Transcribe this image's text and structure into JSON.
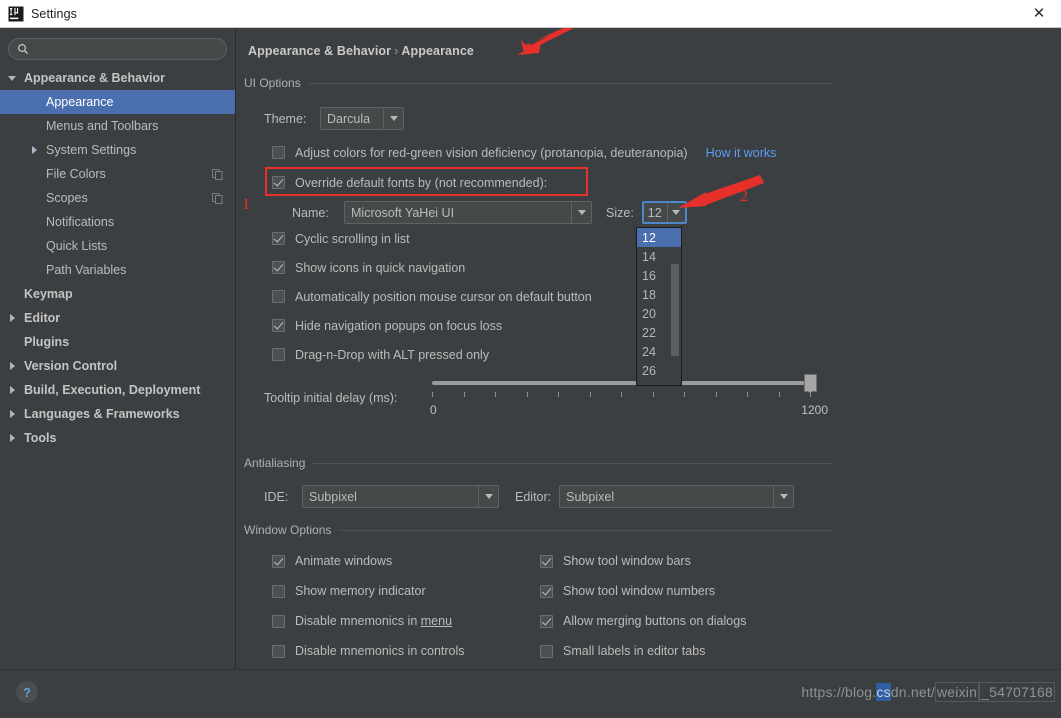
{
  "window": {
    "title": "Settings",
    "app_icon": "intellij-idea-icon",
    "close_label": "✕"
  },
  "sidebar": {
    "search": {
      "value": "",
      "placeholder": "",
      "icon": "search-icon"
    },
    "items": [
      {
        "label": "Appearance & Behavior",
        "level": 0,
        "twisty": "down",
        "bold": true,
        "selected": false,
        "copy": false
      },
      {
        "label": "Appearance",
        "level": 1,
        "twisty": "none",
        "bold": false,
        "selected": true,
        "copy": false
      },
      {
        "label": "Menus and Toolbars",
        "level": 1,
        "twisty": "none",
        "bold": false,
        "selected": false,
        "copy": false
      },
      {
        "label": "System Settings",
        "level": 1,
        "twisty": "right",
        "bold": false,
        "selected": false,
        "copy": false
      },
      {
        "label": "File Colors",
        "level": 1,
        "twisty": "none",
        "bold": false,
        "selected": false,
        "copy": true
      },
      {
        "label": "Scopes",
        "level": 1,
        "twisty": "none",
        "bold": false,
        "selected": false,
        "copy": true
      },
      {
        "label": "Notifications",
        "level": 1,
        "twisty": "none",
        "bold": false,
        "selected": false,
        "copy": false
      },
      {
        "label": "Quick Lists",
        "level": 1,
        "twisty": "none",
        "bold": false,
        "selected": false,
        "copy": false
      },
      {
        "label": "Path Variables",
        "level": 1,
        "twisty": "none",
        "bold": false,
        "selected": false,
        "copy": false
      },
      {
        "label": "Keymap",
        "level": 0,
        "twisty": "none",
        "bold": true,
        "selected": false,
        "copy": false
      },
      {
        "label": "Editor",
        "level": 0,
        "twisty": "right",
        "bold": true,
        "selected": false,
        "copy": false
      },
      {
        "label": "Plugins",
        "level": 0,
        "twisty": "none",
        "bold": true,
        "selected": false,
        "copy": false
      },
      {
        "label": "Version Control",
        "level": 0,
        "twisty": "right",
        "bold": true,
        "selected": false,
        "copy": false
      },
      {
        "label": "Build, Execution, Deployment",
        "level": 0,
        "twisty": "right",
        "bold": true,
        "selected": false,
        "copy": false
      },
      {
        "label": "Languages & Frameworks",
        "level": 0,
        "twisty": "right",
        "bold": true,
        "selected": false,
        "copy": false
      },
      {
        "label": "Tools",
        "level": 0,
        "twisty": "right",
        "bold": true,
        "selected": false,
        "copy": false
      }
    ]
  },
  "breadcrumb": {
    "parent": "Appearance & Behavior",
    "separator": "›",
    "current": "Appearance"
  },
  "ui_options": {
    "title": "UI Options",
    "theme_label": "Theme:",
    "theme_value": "Darcula",
    "adjust_colors_label": "Adjust colors for red-green vision deficiency (protanopia, deuteranopia)",
    "adjust_colors_checked": false,
    "how_it_works_link": "How it works",
    "override_fonts_label": "Override default fonts by (not recommended):",
    "override_fonts_checked": true,
    "name_label": "Name:",
    "name_value": "Microsoft YaHei UI",
    "size_label": "Size:",
    "size_value": "12",
    "size_options": [
      "12",
      "14",
      "16",
      "18",
      "20",
      "22",
      "24",
      "26"
    ],
    "size_selected": "12",
    "checkboxes": [
      {
        "label": "Cyclic scrolling in list",
        "checked": true
      },
      {
        "label": "Show icons in quick navigation",
        "checked": true
      },
      {
        "label": "Automatically position mouse cursor on default button",
        "checked": false
      },
      {
        "label": "Hide navigation popups on focus loss",
        "checked": true
      },
      {
        "label": "Drag-n-Drop with ALT pressed only",
        "checked": false
      }
    ],
    "tooltip_delay_label": "Tooltip initial delay (ms):",
    "tooltip_delay_min": "0",
    "tooltip_delay_max": "1200",
    "tooltip_delay_value": 1200
  },
  "antialiasing": {
    "title": "Antialiasing",
    "ide_label": "IDE:",
    "ide_value": "Subpixel",
    "editor_label": "Editor:",
    "editor_value": "Subpixel"
  },
  "window_options": {
    "title": "Window Options",
    "left_column": [
      {
        "label": "Animate windows",
        "checked": true
      },
      {
        "label": "Show memory indicator",
        "checked": false
      },
      {
        "label": "Disable mnemonics in menu",
        "checked": false,
        "underline": "menu"
      },
      {
        "label": "Disable mnemonics in controls",
        "checked": false,
        "clipped": true
      }
    ],
    "right_column": [
      {
        "label": "Show tool window bars",
        "checked": true
      },
      {
        "label": "Show tool window numbers",
        "checked": true
      },
      {
        "label": "Allow merging buttons on dialogs",
        "checked": true
      },
      {
        "label": "Small labels in editor tabs",
        "checked": false,
        "clipped": true
      }
    ]
  },
  "footer": {
    "help_label": "?",
    "watermark_prefix": "https://blog.",
    "watermark_hl": "cs",
    "watermark_mid": "dn.net/",
    "watermark_box1": "weixin",
    "watermark_suffix": "_54707168"
  },
  "annotations": {
    "marker_1": "1",
    "marker_2": "2",
    "accent_red": "#e8302a",
    "selection_blue": "#4b6eaf",
    "link_blue": "#589df6"
  }
}
